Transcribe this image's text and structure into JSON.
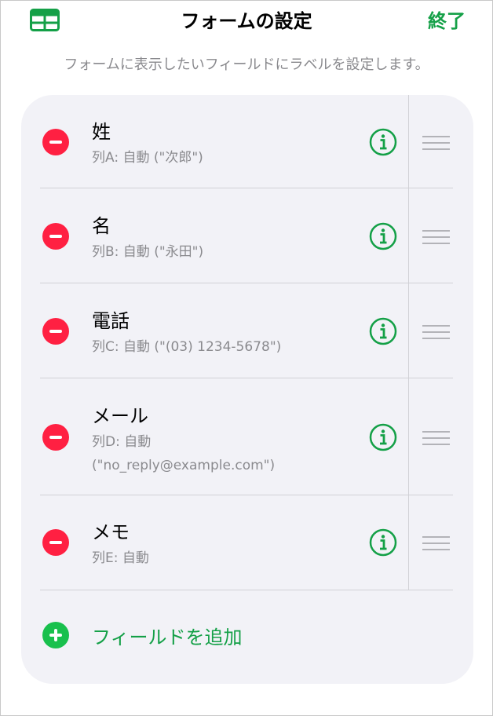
{
  "header": {
    "title": "フォームの設定",
    "done_label": "終了"
  },
  "hint": "フォームに表示したいフィールドにラベルを設定します。",
  "fields": [
    {
      "label": "姓",
      "sub": "列A: 自動 (\"次郎\")"
    },
    {
      "label": "名",
      "sub": "列B: 自動 (\"永田\")"
    },
    {
      "label": "電話",
      "sub": "列C: 自動 (\"(03) 1234-5678\")"
    },
    {
      "label": "メール",
      "sub1": "列D: 自動",
      "sub2": "(\"no_reply@example.com\")"
    },
    {
      "label": "メモ",
      "sub": "列E: 自動"
    }
  ],
  "add_field_label": "フィールドを追加",
  "colors": {
    "accent": "#14a047",
    "delete": "#ff2042",
    "add": "#19c04d"
  }
}
